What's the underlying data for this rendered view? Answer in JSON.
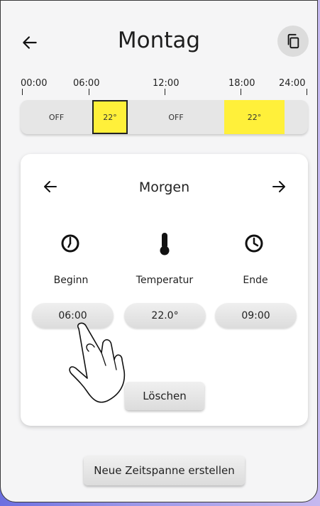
{
  "header": {
    "title": "Montag",
    "back_icon": "arrow-left-icon",
    "copy_icon": "copy-icon"
  },
  "timeline": {
    "ticks": [
      "00:00",
      "06:00",
      "12:00",
      "18:00",
      "24:00"
    ],
    "segments": [
      {
        "label": "OFF",
        "state": "off"
      },
      {
        "label": "22°",
        "state": "on",
        "selected": true
      },
      {
        "label": "OFF",
        "state": "off"
      },
      {
        "label": "22°",
        "state": "on"
      }
    ],
    "on_color": "#fff03a",
    "off_color": "#e6e6e6"
  },
  "period": {
    "title": "Morgen",
    "prev_icon": "arrow-left-icon",
    "next_icon": "arrow-right-icon",
    "columns": [
      {
        "icon": "clock-start-icon",
        "label": "Beginn",
        "value": "06:00"
      },
      {
        "icon": "thermometer-icon",
        "label": "Temperatur",
        "value": "22.0°"
      },
      {
        "icon": "clock-end-icon",
        "label": "Ende",
        "value": "09:00"
      }
    ],
    "delete_label": "Löschen"
  },
  "footer": {
    "new_label": "Neue Zeitspanne erstellen"
  }
}
